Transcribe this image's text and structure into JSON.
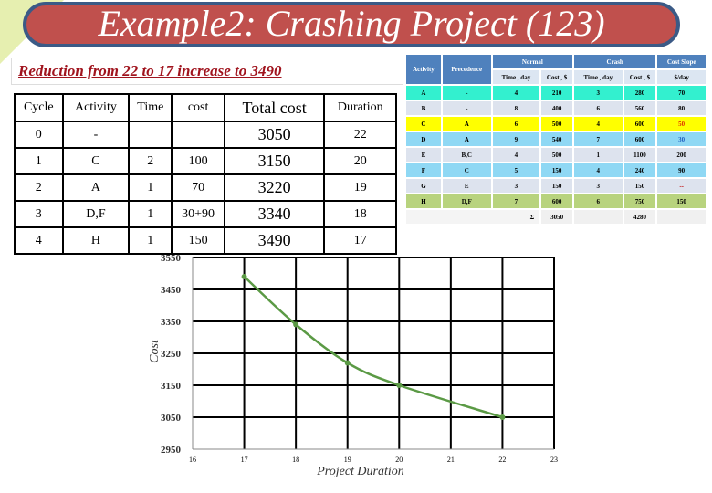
{
  "title": "Example2: Crashing Project (123)",
  "subtitle": "Reduction from 22 to 17 increase to 3490",
  "cycle_table": {
    "headers": [
      "Cycle",
      "Activity",
      "Time",
      "cost",
      "Total cost",
      "Duration"
    ],
    "rows": [
      [
        "0",
        "-",
        "",
        "",
        "3050",
        "22"
      ],
      [
        "1",
        "C",
        "2",
        "100",
        "3150",
        "20"
      ],
      [
        "2",
        "A",
        "1",
        "70",
        "3220",
        "19"
      ],
      [
        "3",
        "D,F",
        "1",
        "30+90",
        "3340",
        "18"
      ],
      [
        "4",
        "H",
        "1",
        "150",
        "3490",
        "17"
      ]
    ]
  },
  "activity_table": {
    "headers": {
      "activity": "Activity",
      "precedence": "Precedence",
      "normal": "Normal",
      "crash": "Crash",
      "slope": "Cost Slope",
      "time": "Time , day",
      "cost": "Cost , $",
      "slope_unit": "$/day"
    },
    "rows": [
      {
        "cells": [
          "A",
          "-",
          "4",
          "210",
          "3",
          "280",
          "70"
        ],
        "color": "#33f0cf"
      },
      {
        "cells": [
          "B",
          "-",
          "8",
          "400",
          "6",
          "560",
          "80"
        ],
        "color": "#dde3ee"
      },
      {
        "cells": [
          "C",
          "A",
          "6",
          "500",
          "4",
          "600",
          "50"
        ],
        "color": "#ffff00",
        "slope_color": "#e03000"
      },
      {
        "cells": [
          "D",
          "A",
          "9",
          "540",
          "7",
          "600",
          "30"
        ],
        "color": "#8fd8f4",
        "slope_color": "#1f5fc0"
      },
      {
        "cells": [
          "E",
          "B,C",
          "4",
          "500",
          "1",
          "1100",
          "200"
        ],
        "color": "#dde3ee"
      },
      {
        "cells": [
          "F",
          "C",
          "5",
          "150",
          "4",
          "240",
          "90"
        ],
        "color": "#8fd8f4"
      },
      {
        "cells": [
          "G",
          "E",
          "3",
          "150",
          "3",
          "150",
          "--"
        ],
        "color": "#dde3ee",
        "slope_color": "#c00000"
      },
      {
        "cells": [
          "H",
          "D,F",
          "7",
          "600",
          "6",
          "750",
          "150"
        ],
        "color": "#b8d37e"
      }
    ],
    "sum_symbol": "Σ",
    "normal_total": "3050",
    "crash_total": "4280"
  },
  "chart_data": {
    "type": "line",
    "xlabel": "Project Duration",
    "ylabel": "Cost",
    "x": [
      17,
      18,
      19,
      20,
      22
    ],
    "y": [
      3490,
      3340,
      3220,
      3150,
      3050
    ],
    "xlim": [
      16,
      23
    ],
    "ylim": [
      2950,
      3550
    ],
    "xticks": [
      "16",
      "17",
      "18",
      "19",
      "20",
      "21",
      "22",
      "23"
    ],
    "yticks": [
      "2950",
      "3050",
      "3150",
      "3250",
      "3350",
      "3450",
      "3550"
    ],
    "grid": true,
    "line_color": "#5b9a45",
    "smooth": true
  }
}
